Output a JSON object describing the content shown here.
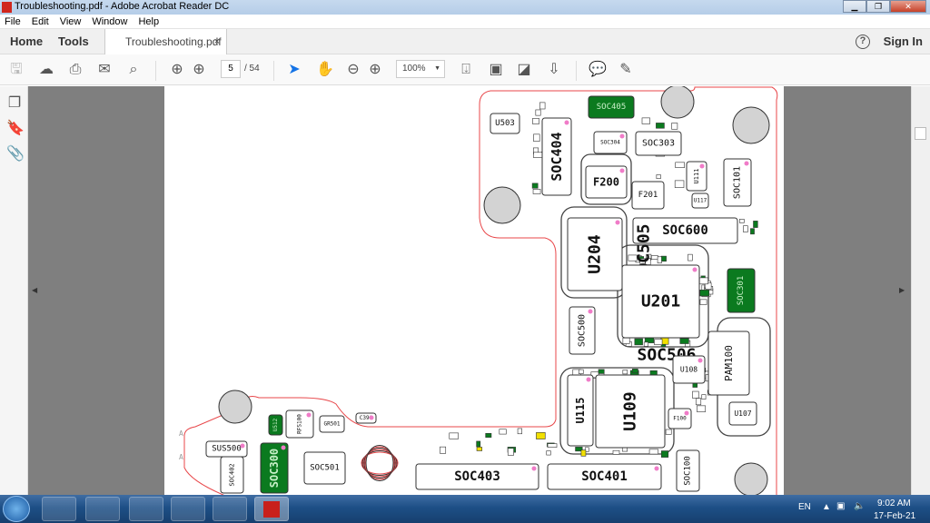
{
  "window": {
    "title": "Troubleshooting.pdf - Adobe Acrobat Reader DC",
    "min": "▁",
    "max": "❐",
    "close": "✕"
  },
  "menu": [
    "File",
    "Edit",
    "View",
    "Window",
    "Help"
  ],
  "tabs": {
    "home": "Home",
    "tools": "Tools",
    "document": "Troubleshooting.pdf",
    "close": "×",
    "help": "?",
    "signin": "Sign In"
  },
  "toolbar": {
    "page_current": "5",
    "page_total": "/ 54",
    "zoom": "100%",
    "zoom_caret": "▼",
    "icons": [
      "save-icon",
      "upload-icon",
      "print-icon",
      "email-icon",
      "search-icon",
      "page-up-icon",
      "page-down-icon",
      "select-cursor-icon",
      "hand-tool-icon",
      "zoom-out-icon",
      "zoom-in-icon",
      "fit-width-icon",
      "fit-page-icon",
      "full-screen-icon",
      "scroll-mode-icon",
      "comment-icon",
      "highlight-pen-icon"
    ],
    "accent": "#1473e6"
  },
  "left_panel": {
    "icons": [
      "page-thumbnails-icon",
      "bookmark-icon",
      "attachment-icon"
    ]
  },
  "pcb": {
    "outline_color": "#e8474a",
    "green": "#0b7a1f",
    "components": [
      "U503",
      "SOC404",
      "SOC405",
      "SOC304",
      "SOC303",
      "F200",
      "F201",
      "U111",
      "U117",
      "SOC101",
      "SOC600",
      "U204",
      "SOC505",
      "U201",
      "SOC301",
      "SOC500",
      "SOC506",
      "U108",
      "PAM100",
      "U115",
      "U109",
      "F100",
      "U107",
      "SOC401",
      "SOC100",
      "SOC403",
      "SOC501",
      "SOC300",
      "SOC402",
      "SUS500",
      "U512",
      "RFS100",
      "GR501",
      "C390"
    ],
    "marks": [
      "A",
      "A"
    ]
  },
  "taskbar": {
    "lang": "EN",
    "time": "9:02 AM",
    "date": "17-Feb-21",
    "apps": [
      "skype",
      "internet-explorer",
      "chrome-like",
      "virtualbox",
      "file-explorer",
      "acrobat-reader"
    ]
  }
}
